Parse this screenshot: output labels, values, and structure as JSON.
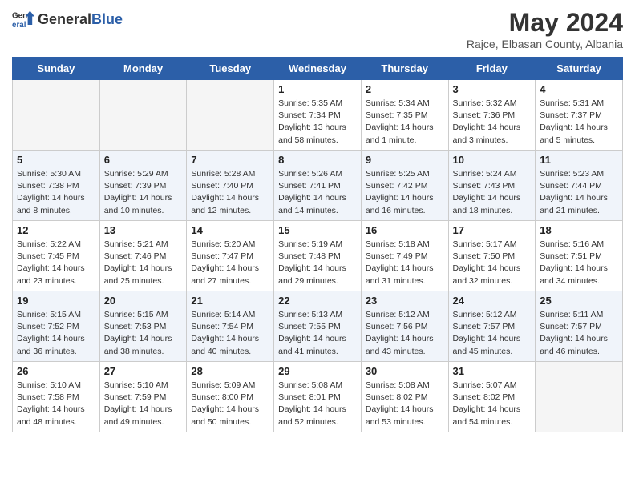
{
  "header": {
    "logo_general": "General",
    "logo_blue": "Blue",
    "title": "May 2024",
    "subtitle": "Rajce, Elbasan County, Albania"
  },
  "days": [
    "Sunday",
    "Monday",
    "Tuesday",
    "Wednesday",
    "Thursday",
    "Friday",
    "Saturday"
  ],
  "weeks": [
    [
      {
        "num": "",
        "sunrise": "",
        "sunset": "",
        "daylight": ""
      },
      {
        "num": "",
        "sunrise": "",
        "sunset": "",
        "daylight": ""
      },
      {
        "num": "",
        "sunrise": "",
        "sunset": "",
        "daylight": ""
      },
      {
        "num": "1",
        "sunrise": "Sunrise: 5:35 AM",
        "sunset": "Sunset: 7:34 PM",
        "daylight": "Daylight: 13 hours and 58 minutes."
      },
      {
        "num": "2",
        "sunrise": "Sunrise: 5:34 AM",
        "sunset": "Sunset: 7:35 PM",
        "daylight": "Daylight: 14 hours and 1 minute."
      },
      {
        "num": "3",
        "sunrise": "Sunrise: 5:32 AM",
        "sunset": "Sunset: 7:36 PM",
        "daylight": "Daylight: 14 hours and 3 minutes."
      },
      {
        "num": "4",
        "sunrise": "Sunrise: 5:31 AM",
        "sunset": "Sunset: 7:37 PM",
        "daylight": "Daylight: 14 hours and 5 minutes."
      }
    ],
    [
      {
        "num": "5",
        "sunrise": "Sunrise: 5:30 AM",
        "sunset": "Sunset: 7:38 PM",
        "daylight": "Daylight: 14 hours and 8 minutes."
      },
      {
        "num": "6",
        "sunrise": "Sunrise: 5:29 AM",
        "sunset": "Sunset: 7:39 PM",
        "daylight": "Daylight: 14 hours and 10 minutes."
      },
      {
        "num": "7",
        "sunrise": "Sunrise: 5:28 AM",
        "sunset": "Sunset: 7:40 PM",
        "daylight": "Daylight: 14 hours and 12 minutes."
      },
      {
        "num": "8",
        "sunrise": "Sunrise: 5:26 AM",
        "sunset": "Sunset: 7:41 PM",
        "daylight": "Daylight: 14 hours and 14 minutes."
      },
      {
        "num": "9",
        "sunrise": "Sunrise: 5:25 AM",
        "sunset": "Sunset: 7:42 PM",
        "daylight": "Daylight: 14 hours and 16 minutes."
      },
      {
        "num": "10",
        "sunrise": "Sunrise: 5:24 AM",
        "sunset": "Sunset: 7:43 PM",
        "daylight": "Daylight: 14 hours and 18 minutes."
      },
      {
        "num": "11",
        "sunrise": "Sunrise: 5:23 AM",
        "sunset": "Sunset: 7:44 PM",
        "daylight": "Daylight: 14 hours and 21 minutes."
      }
    ],
    [
      {
        "num": "12",
        "sunrise": "Sunrise: 5:22 AM",
        "sunset": "Sunset: 7:45 PM",
        "daylight": "Daylight: 14 hours and 23 minutes."
      },
      {
        "num": "13",
        "sunrise": "Sunrise: 5:21 AM",
        "sunset": "Sunset: 7:46 PM",
        "daylight": "Daylight: 14 hours and 25 minutes."
      },
      {
        "num": "14",
        "sunrise": "Sunrise: 5:20 AM",
        "sunset": "Sunset: 7:47 PM",
        "daylight": "Daylight: 14 hours and 27 minutes."
      },
      {
        "num": "15",
        "sunrise": "Sunrise: 5:19 AM",
        "sunset": "Sunset: 7:48 PM",
        "daylight": "Daylight: 14 hours and 29 minutes."
      },
      {
        "num": "16",
        "sunrise": "Sunrise: 5:18 AM",
        "sunset": "Sunset: 7:49 PM",
        "daylight": "Daylight: 14 hours and 31 minutes."
      },
      {
        "num": "17",
        "sunrise": "Sunrise: 5:17 AM",
        "sunset": "Sunset: 7:50 PM",
        "daylight": "Daylight: 14 hours and 32 minutes."
      },
      {
        "num": "18",
        "sunrise": "Sunrise: 5:16 AM",
        "sunset": "Sunset: 7:51 PM",
        "daylight": "Daylight: 14 hours and 34 minutes."
      }
    ],
    [
      {
        "num": "19",
        "sunrise": "Sunrise: 5:15 AM",
        "sunset": "Sunset: 7:52 PM",
        "daylight": "Daylight: 14 hours and 36 minutes."
      },
      {
        "num": "20",
        "sunrise": "Sunrise: 5:15 AM",
        "sunset": "Sunset: 7:53 PM",
        "daylight": "Daylight: 14 hours and 38 minutes."
      },
      {
        "num": "21",
        "sunrise": "Sunrise: 5:14 AM",
        "sunset": "Sunset: 7:54 PM",
        "daylight": "Daylight: 14 hours and 40 minutes."
      },
      {
        "num": "22",
        "sunrise": "Sunrise: 5:13 AM",
        "sunset": "Sunset: 7:55 PM",
        "daylight": "Daylight: 14 hours and 41 minutes."
      },
      {
        "num": "23",
        "sunrise": "Sunrise: 5:12 AM",
        "sunset": "Sunset: 7:56 PM",
        "daylight": "Daylight: 14 hours and 43 minutes."
      },
      {
        "num": "24",
        "sunrise": "Sunrise: 5:12 AM",
        "sunset": "Sunset: 7:57 PM",
        "daylight": "Daylight: 14 hours and 45 minutes."
      },
      {
        "num": "25",
        "sunrise": "Sunrise: 5:11 AM",
        "sunset": "Sunset: 7:57 PM",
        "daylight": "Daylight: 14 hours and 46 minutes."
      }
    ],
    [
      {
        "num": "26",
        "sunrise": "Sunrise: 5:10 AM",
        "sunset": "Sunset: 7:58 PM",
        "daylight": "Daylight: 14 hours and 48 minutes."
      },
      {
        "num": "27",
        "sunrise": "Sunrise: 5:10 AM",
        "sunset": "Sunset: 7:59 PM",
        "daylight": "Daylight: 14 hours and 49 minutes."
      },
      {
        "num": "28",
        "sunrise": "Sunrise: 5:09 AM",
        "sunset": "Sunset: 8:00 PM",
        "daylight": "Daylight: 14 hours and 50 minutes."
      },
      {
        "num": "29",
        "sunrise": "Sunrise: 5:08 AM",
        "sunset": "Sunset: 8:01 PM",
        "daylight": "Daylight: 14 hours and 52 minutes."
      },
      {
        "num": "30",
        "sunrise": "Sunrise: 5:08 AM",
        "sunset": "Sunset: 8:02 PM",
        "daylight": "Daylight: 14 hours and 53 minutes."
      },
      {
        "num": "31",
        "sunrise": "Sunrise: 5:07 AM",
        "sunset": "Sunset: 8:02 PM",
        "daylight": "Daylight: 14 hours and 54 minutes."
      },
      {
        "num": "",
        "sunrise": "",
        "sunset": "",
        "daylight": ""
      }
    ]
  ]
}
